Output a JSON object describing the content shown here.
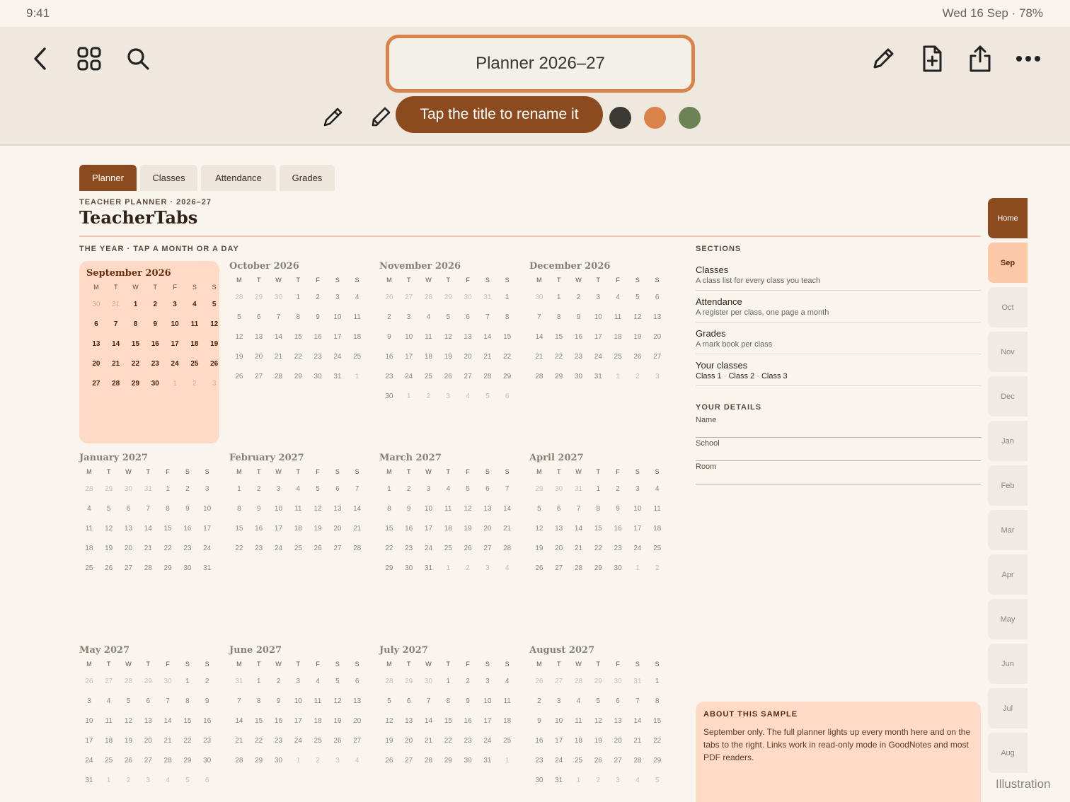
{
  "status": {
    "time": "9:41",
    "right": "Wed 16 Sep · 78%"
  },
  "toolbar": {
    "title": "Planner 2026–27",
    "tip": "Tap the title to rename it",
    "icons": [
      "back-icon",
      "grid-icon",
      "search-icon",
      "pen-icon",
      "add-page-icon",
      "share-icon",
      "more-icon",
      "pencil-icon",
      "highlighter-icon"
    ],
    "swatches": [
      "#3d3a35",
      "#d9824a",
      "#6e8355"
    ]
  },
  "tabs": [
    "Planner",
    "Classes",
    "Attendance",
    "Grades"
  ],
  "eyebrow": "TEACHER PLANNER · 2026–27",
  "brand": "TeacherTabs",
  "year_label": "THE YEAR · TAP A MONTH OR A DAY",
  "weekdays": [
    "M",
    "T",
    "W",
    "T",
    "F",
    "S",
    "S"
  ],
  "months": [
    {
      "name": "September 2026",
      "first": 2,
      "prev_days": 31,
      "count": 30,
      "active": true
    },
    {
      "name": "October 2026",
      "first": 3,
      "prev_days": 30,
      "count": 31
    },
    {
      "name": "November 2026",
      "first": 6,
      "prev_days": 31,
      "count": 30
    },
    {
      "name": "December 2026",
      "first": 1,
      "prev_days": 30,
      "count": 31
    },
    {
      "name": "January 2027",
      "first": 4,
      "prev_days": 31,
      "count": 31
    },
    {
      "name": "February 2027",
      "first": 0,
      "prev_days": 31,
      "count": 28
    },
    {
      "name": "March 2027",
      "first": 0,
      "prev_days": 28,
      "count": 31
    },
    {
      "name": "April 2027",
      "first": 3,
      "prev_days": 31,
      "count": 30
    },
    {
      "name": "May 2027",
      "first": 5,
      "prev_days": 30,
      "count": 31
    },
    {
      "name": "June 2027",
      "first": 1,
      "prev_days": 31,
      "count": 30
    },
    {
      "name": "July 2027",
      "first": 3,
      "prev_days": 30,
      "count": 31
    },
    {
      "name": "August 2027",
      "first": 6,
      "prev_days": 31,
      "count": 31
    }
  ],
  "sections": {
    "heading": "SECTIONS",
    "items": [
      {
        "name": "Classes",
        "desc": "A class list for every class you teach"
      },
      {
        "name": "Attendance",
        "desc": "A register per class, one page a month"
      },
      {
        "name": "Grades",
        "desc": "A mark book per class"
      }
    ],
    "your_classes": {
      "name": "Your classes",
      "classes": [
        "Class 1",
        "Class 2",
        "Class 3"
      ]
    }
  },
  "details": {
    "heading": "YOUR DETAILS",
    "fields": [
      "Name",
      "School",
      "Room"
    ]
  },
  "about": {
    "title": "ABOUT THIS SAMPLE",
    "text": "September only. The full planner lights up every month here and on the tabs to the right. Links work in read-only mode in GoodNotes and most PDF readers."
  },
  "side_tabs": [
    "Home",
    "Sep",
    "Oct",
    "Nov",
    "Dec",
    "Jan",
    "Feb",
    "Mar",
    "Apr",
    "May",
    "Jun",
    "Jul",
    "Aug"
  ],
  "watermark": "Illustration"
}
